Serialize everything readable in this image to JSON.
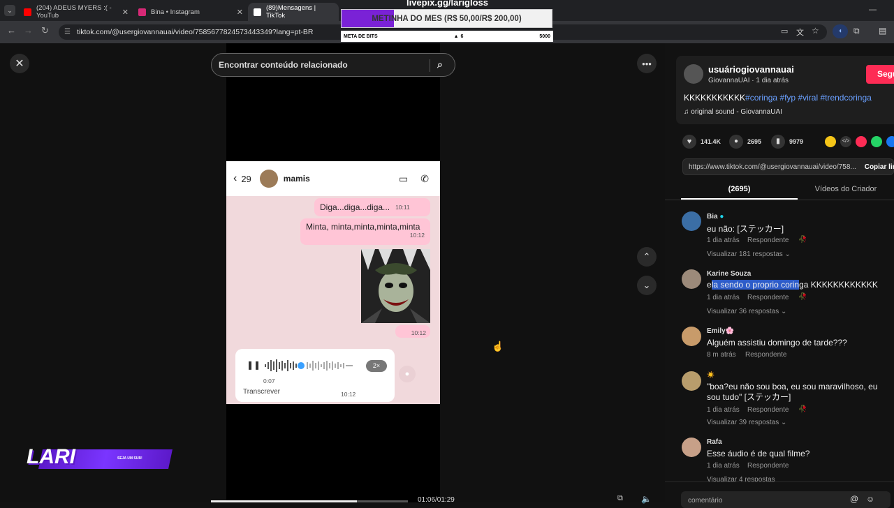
{
  "tabs": [
    {
      "title": "(204) ADEUS MYERS :( - YouTub",
      "favicon_color": "#ff0000"
    },
    {
      "title": "Bina • Instagram",
      "favicon_color": "#d62976"
    },
    {
      "title": "(89)Mensagens | TikTok",
      "favicon_color": "#ffffff"
    }
  ],
  "address": {
    "url": "tiktok.com/@usergiovannauai/video/7585677824573443349?lang=pt-BR"
  },
  "stream_overlay": {
    "livepix": "livepix.gg/larigloss",
    "meta_mes": "METINHA DO MES (R$ 50,00/R$ 200,00)",
    "meta_mes_progress": 0.25,
    "meta_bits_label": "META DE BITS",
    "meta_bits_value": "6",
    "meta_bits_goal": "5000",
    "logo_text": "LARI",
    "sub_text": "SEJA UM SUB!"
  },
  "search": {
    "placeholder": "Encontrar conteúdo relacionado"
  },
  "video": {
    "chat": {
      "back_count": "29",
      "contact": "mamis",
      "messages": [
        {
          "text": "Diga...diga...diga...",
          "time": "10:11"
        },
        {
          "text": "Minta, minta,minta,minta,minta",
          "time": "10:12"
        }
      ],
      "sticker_time": "10:12",
      "audio": {
        "duration": "0:07",
        "speed": "2×",
        "transcribe": "Transcrever",
        "time": "10:12"
      }
    },
    "time": "01:06/01:29",
    "progress": 0.74
  },
  "post": {
    "username": "usuáriogiovannauai",
    "subline": "GiovannaUAI · 1 dia atrás",
    "follow": "Seguir",
    "caption_text": "KKKKKKKKKKK",
    "hashtags": "#coringa #fyp #viral #trendcoringa",
    "sound": "original sound - GiovannaUAI",
    "likes": "141.4K",
    "comments": "2695",
    "saves": "9979",
    "link": "https://www.tiktok.com/@usergiovannauai/video/758...",
    "copy": "Copiar link",
    "tab_comments": "(2695)",
    "tab_creator": "Vídeos do Criador"
  },
  "comments": [
    {
      "name": "Bia",
      "text": "eu não: [ステッカー]",
      "time": "1 dia atrás",
      "reply": "Respondente",
      "view": "Visualizar 181 respostas"
    },
    {
      "name": "Karine Souza",
      "text_pre": "e",
      "text_hl": "la sendo o proprio corin",
      "text_post": "ga KKKKKKKKKKKK",
      "time": "1 dia atrás",
      "reply": "Respondente",
      "view": "Visualizar 36 respostas"
    },
    {
      "name": "Emily🌸",
      "text": "Alguém assistiu domingo de tarde???",
      "time": "8 m atrás",
      "reply": "Respondente"
    },
    {
      "name": "☀️",
      "text": "\"boa?eu não sou boa, eu sou maravilhoso, eu sou tudo\" [ステッカー]",
      "time": "1 dia atrás",
      "reply": "Respondente",
      "view": "Visualizar 39 respostas"
    },
    {
      "name": "Rafa",
      "text": "Esse áudio é de qual filme?",
      "time": "1 dia atrás",
      "reply": "Respondente",
      "view": "Visualizar 4 respostas"
    }
  ],
  "comment_input": {
    "placeholder": "comentário"
  }
}
